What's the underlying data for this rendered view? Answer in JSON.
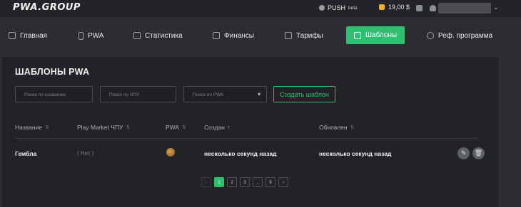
{
  "topbar": {
    "logo": "PWA.GROUP",
    "push_label": "PUSH",
    "push_badge": "beta",
    "balance": "19,00 $",
    "icons": [
      "push-icon",
      "wallet-icon",
      "chat-icon",
      "bell-icon"
    ],
    "user_chevron": "⌄"
  },
  "nav": {
    "items": [
      {
        "label": "Главная",
        "icon": "home-icon"
      },
      {
        "label": "PWA",
        "icon": "phone-icon"
      },
      {
        "label": "Статистика",
        "icon": "chart-icon"
      },
      {
        "label": "Финансы",
        "icon": "finance-icon"
      },
      {
        "label": "Тарифы",
        "icon": "tariff-icon"
      },
      {
        "label": "Шаблоны",
        "icon": "template-icon"
      },
      {
        "label": "Реф. программа",
        "icon": "link-icon"
      }
    ],
    "active_index": 5,
    "accent": "#2fbf71"
  },
  "page": {
    "title": "ШАБЛОНЫ PWA",
    "filters": {
      "name_placeholder": "Поиск по названию",
      "slug_placeholder": "Поиск по ЧПУ",
      "pwa_select": "Поиск по PWA"
    },
    "create_button": "Создать шаблон"
  },
  "table": {
    "columns": [
      "Название",
      "Play Market ЧПУ",
      "PWA",
      "Создан",
      "Обновлен"
    ],
    "sort_icon": "⇅",
    "sort_active_icon": "↑",
    "rows": [
      {
        "name": "Гембла",
        "slug": "( Нет )",
        "pwa_icon": "pwa-avatar",
        "created": "несколько секунд назад",
        "updated": "несколько секунд назад"
      }
    ]
  },
  "pagination": {
    "prev": "‹",
    "pages": [
      "1",
      "2",
      "3",
      "..",
      "9"
    ],
    "next": "›",
    "current": "1"
  }
}
